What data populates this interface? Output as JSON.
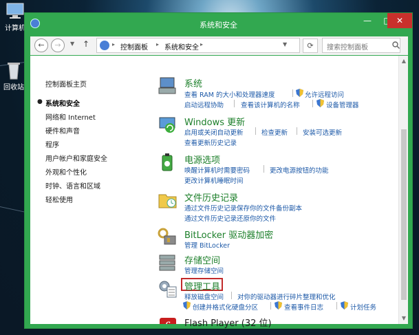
{
  "desktop": {
    "icons": [
      {
        "label": "计算机"
      },
      {
        "label": "回收站"
      }
    ]
  },
  "window": {
    "title": "系统和安全",
    "buttons": {
      "minimize": "—",
      "maximize": "□",
      "close": "✕"
    }
  },
  "address": {
    "back": "←",
    "forward": "→",
    "up": "↑",
    "dropdown": "▼",
    "refresh": "⟳",
    "breadcrumbs": [
      "控制面板",
      "系统和安全"
    ],
    "search_placeholder": "搜索控制面板"
  },
  "sidebar": {
    "items": [
      {
        "label": "控制面板主页"
      },
      {
        "label": "系统和安全",
        "current": true
      },
      {
        "label": "网络和 Internet"
      },
      {
        "label": "硬件和声音"
      },
      {
        "label": "程序"
      },
      {
        "label": "用户帐户和家庭安全"
      },
      {
        "label": "外观和个性化"
      },
      {
        "label": "时钟、语言和区域"
      },
      {
        "label": "轻松使用"
      }
    ]
  },
  "categories": [
    {
      "title": "系统",
      "icon": "system-icon",
      "links": [
        "查看 RAM 的大小和处理器速度",
        "允许远程访问",
        "启动远程协助",
        "查看该计算机的名称",
        "设备管理器"
      ]
    },
    {
      "title": "Windows 更新",
      "icon": "windows-update-icon",
      "links": [
        "启用或关闭自动更新",
        "检查更新",
        "安装可选更新",
        "查看更新历史记录"
      ]
    },
    {
      "title": "电源选项",
      "icon": "power-options-icon",
      "links": [
        "唤醒计算机时需要密码",
        "更改电源按钮的功能",
        "更改计算机睡眠时间"
      ]
    },
    {
      "title": "文件历史记录",
      "icon": "file-history-icon",
      "links": [
        "通过文件历史记录保存你的文件备份副本",
        "通过文件历史记录还原你的文件"
      ]
    },
    {
      "title": "BitLocker 驱动器加密",
      "icon": "bitlocker-icon",
      "links": [
        "管理 BitLocker"
      ]
    },
    {
      "title": "存储空间",
      "icon": "storage-spaces-icon",
      "links": [
        "管理存储空间"
      ]
    },
    {
      "title": "管理工具",
      "icon": "admin-tools-icon",
      "links": [
        "释放磁盘空间",
        "对你的驱动器进行碎片整理和优化",
        "创建并格式化硬盘分区",
        "查看事件日志",
        "计划任务"
      ]
    },
    {
      "title": "Flash Player (32 位)",
      "icon": "flash-player-icon",
      "links": []
    }
  ],
  "colors": {
    "accent": "#32a850",
    "link": "#1e5aa8",
    "category_title": "#1c7f2a",
    "highlight": "#c12a2a",
    "close": "#c9302c"
  }
}
